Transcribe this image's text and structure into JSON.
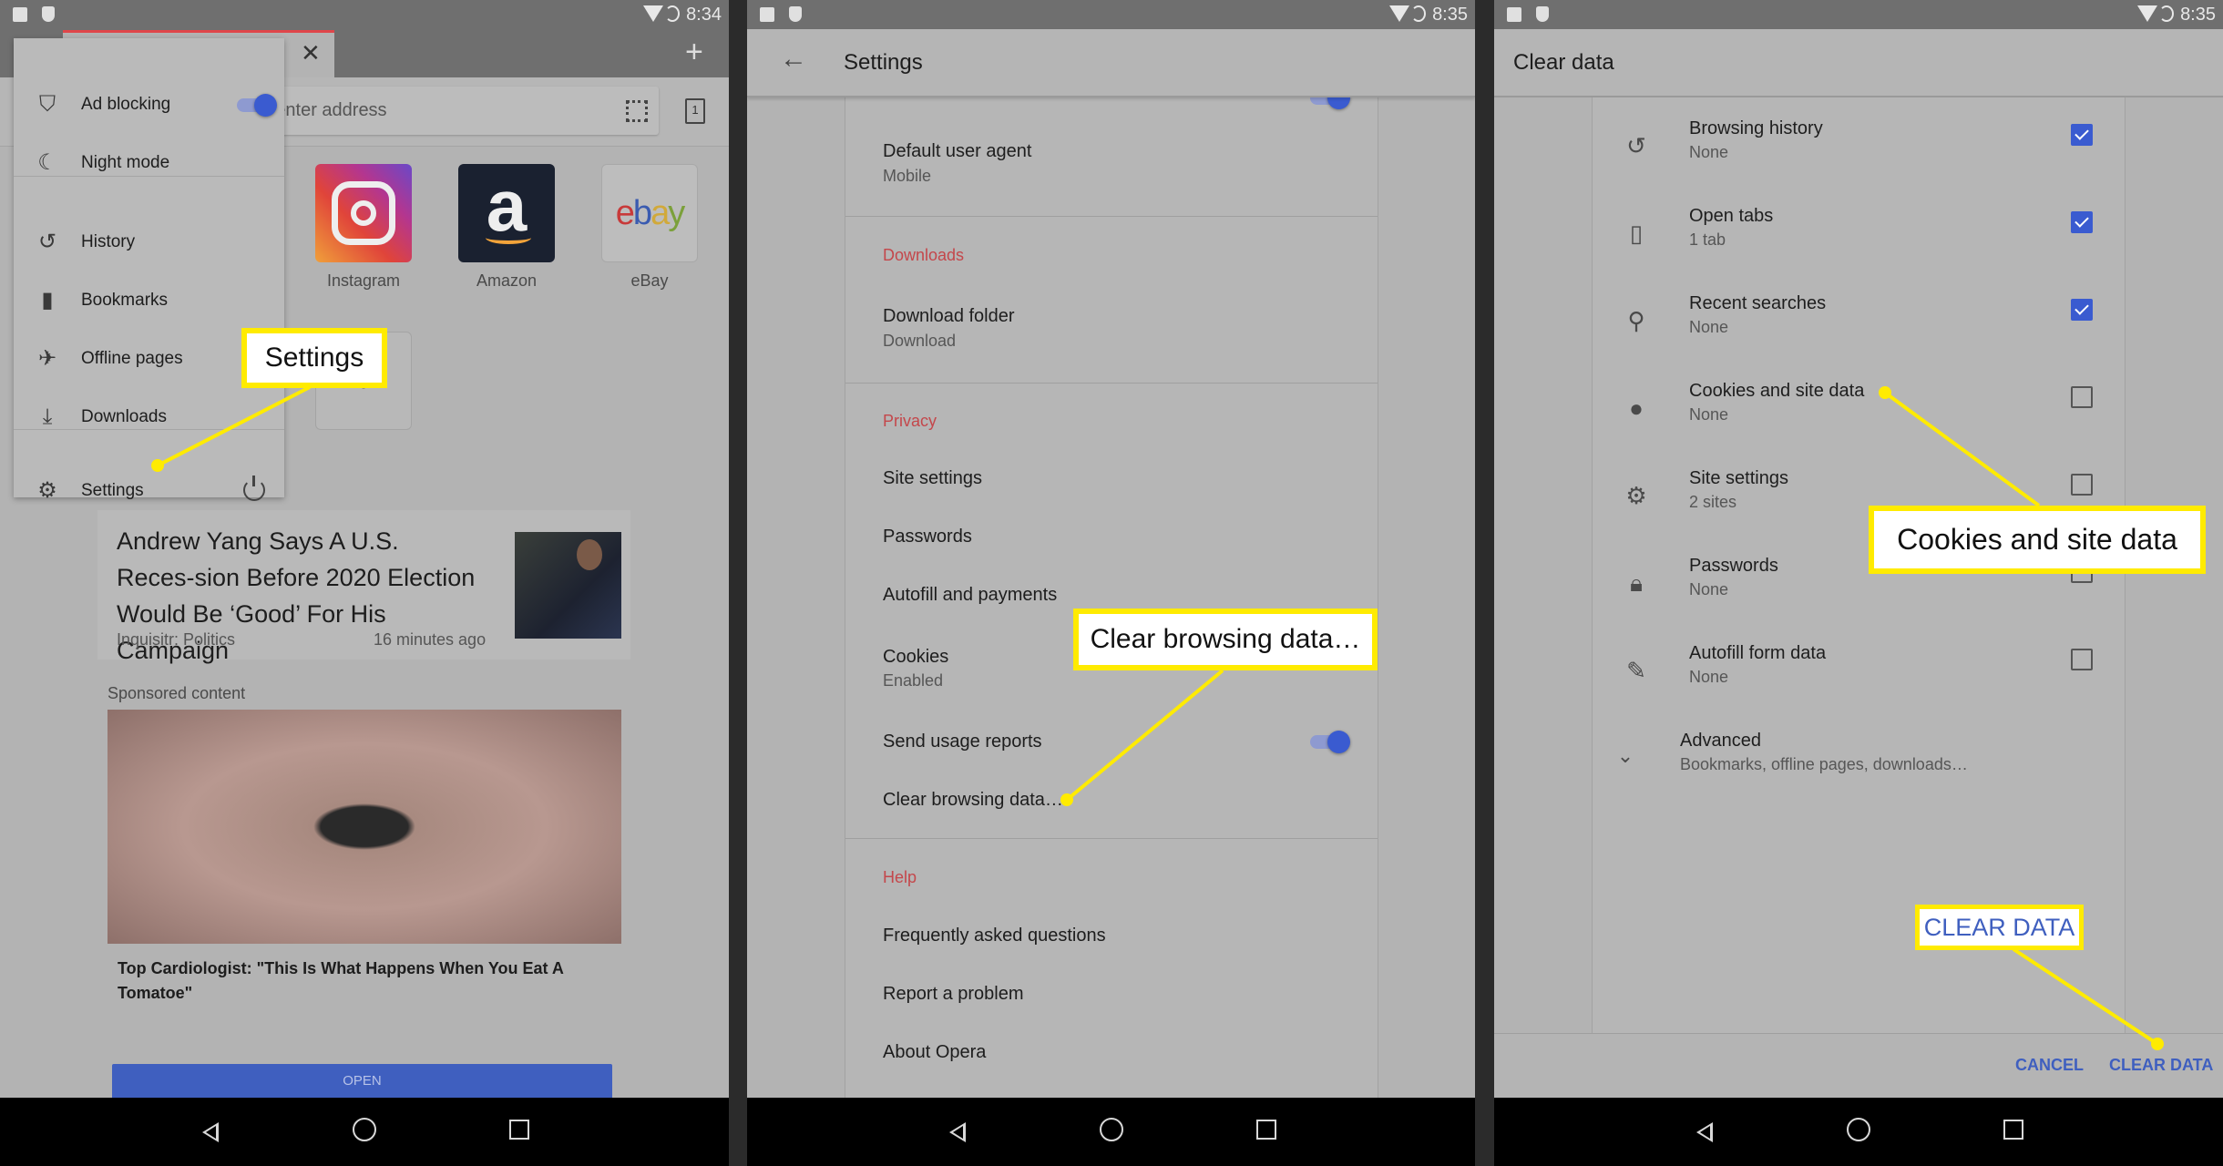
{
  "panel1": {
    "status_time": "8:34",
    "address_placeholder": "Search or enter address",
    "tab_count": "1",
    "menu": {
      "items": [
        {
          "label": "Ad blocking",
          "icon": "shield-icon",
          "toggle": true
        },
        {
          "label": "Night mode",
          "icon": "moon-icon"
        },
        {
          "label": "History",
          "icon": "history-icon"
        },
        {
          "label": "Bookmarks",
          "icon": "bookmark-icon"
        },
        {
          "label": "Offline pages",
          "icon": "airplane-icon"
        },
        {
          "label": "Downloads",
          "icon": "download-icon"
        },
        {
          "label": "Settings",
          "icon": "gear-icon"
        }
      ],
      "power_icon": "power-icon"
    },
    "speed_dials": [
      {
        "label": "Instagram",
        "logo": "Instagram"
      },
      {
        "label": "Amazon",
        "logo": "a"
      },
      {
        "label": "eBay",
        "logo": "ebay"
      }
    ],
    "add_tile": "+",
    "news": {
      "title": "Andrew Yang Says A U.S. Reces-sion Before 2020 Election Would Be ‘Good’ For His Campaign",
      "source": "Inquisitr: Politics",
      "time": "16 minutes ago"
    },
    "sponsored_label": "Sponsored content",
    "ad_title": "Top Cardiologist: \"This Is What Happens When You Eat A Tomatoe\"",
    "open_button": "OPEN",
    "callout": "Settings"
  },
  "panel2": {
    "status_time": "8:35",
    "title": "Settings",
    "items": {
      "default_user_agent": {
        "title": "Default user agent",
        "sub": "Mobile"
      },
      "downloads_header": "Downloads",
      "download_folder": {
        "title": "Download folder",
        "sub": "Download"
      },
      "privacy_header": "Privacy",
      "site_settings": "Site settings",
      "passwords": "Passwords",
      "autofill": "Autofill and payments",
      "cookies": {
        "title": "Cookies",
        "sub": "Enabled"
      },
      "usage_reports": "Send usage reports",
      "clear_browsing": "Clear browsing data…",
      "help_header": "Help",
      "faq": "Frequently asked questions",
      "report": "Report a problem",
      "about": "About Opera"
    },
    "usage_reports_on": true,
    "callout": "Clear browsing data…"
  },
  "panel3": {
    "status_time": "8:35",
    "title": "Clear data",
    "rows": [
      {
        "title": "Browsing history",
        "sub": "None",
        "checked": true,
        "icon": "history-icon"
      },
      {
        "title": "Open tabs",
        "sub": "1 tab",
        "checked": true,
        "icon": "tabs-icon"
      },
      {
        "title": "Recent searches",
        "sub": "None",
        "checked": true,
        "icon": "search-icon"
      },
      {
        "title": "Cookies and site data",
        "sub": "None",
        "checked": false,
        "icon": "cookie-icon"
      },
      {
        "title": "Site settings",
        "sub": "2 sites",
        "checked": false,
        "icon": "gear-icon"
      },
      {
        "title": "Passwords",
        "sub": "None",
        "checked": false,
        "icon": "lock-icon"
      },
      {
        "title": "Autofill form data",
        "sub": "None",
        "checked": false,
        "icon": "pencil-icon"
      }
    ],
    "advanced": {
      "title": "Advanced",
      "sub": "Bookmarks, offline pages, downloads…"
    },
    "cancel_button": "CANCEL",
    "clear_button": "CLEAR DATA",
    "callout_cookies": "Cookies and site data",
    "callout_clear": "CLEAR DATA"
  },
  "colors": {
    "accent": "#3a5bd0",
    "section_header": "#c4474b",
    "callout": "#ffeb00",
    "tab_indicator": "#e0464a"
  }
}
